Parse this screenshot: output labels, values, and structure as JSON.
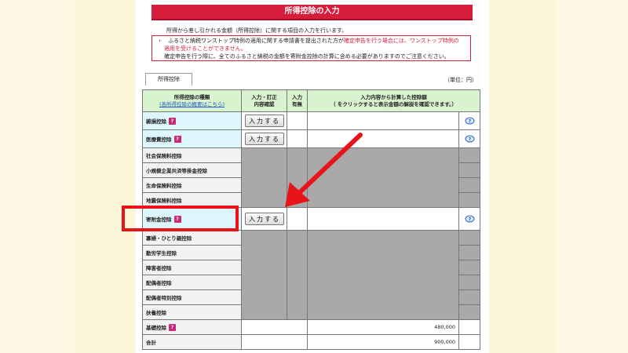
{
  "page": {
    "title": "所得控除の入力",
    "intro": "所得から差し引かれる金額（所得控除）に関する項目の入力を行います。",
    "notice_line1_black": "・　ふるさと納税ワンストップ特例の適用に関する申請書を提出された方が",
    "notice_line1_red": "確定申告を行う場合には、ワンストップ特例の",
    "notice_line2_red": "適用を受けることができません。",
    "notice_line3": "確定申告を行う際に、全てのふるさと納税の金額を寄附金控除の計算に含める必要がありますのでご注意ください。",
    "tab_label": "所得控除",
    "unit": "（単位：円）"
  },
  "table": {
    "headers": {
      "type_line1": "所得控除の種類",
      "type_link": "(各所得控除の概要はこちら)",
      "input_line1": "入力・訂正",
      "input_line2": "内容確認",
      "status_line1": "入力",
      "status_line2": "有無",
      "amount_line1": "入力内容から計算した控除額",
      "amount_line2": "（ をクリックすると表示金額の解説を確認できます。）"
    },
    "button_label": "入力する",
    "help_mark": "?",
    "rows": [
      {
        "label": "雑損控除"
      },
      {
        "label": "医療費控除"
      },
      {
        "label": "社会保険料控除"
      },
      {
        "label": "小規模企業共済等掛金控除"
      },
      {
        "label": "生命保険料控除"
      },
      {
        "label": "地震保険料控除"
      },
      {
        "label": "寄附金控除"
      },
      {
        "label": "寡婦・ひとり親控除"
      },
      {
        "label": "勤労学生控除"
      },
      {
        "label": "障害者控除"
      },
      {
        "label": "配偶者控除"
      },
      {
        "label": "配偶者特別控除"
      },
      {
        "label": "扶養控除"
      },
      {
        "label": "基礎控除",
        "amount": "480,000"
      },
      {
        "label": "合計",
        "amount": "900,000"
      }
    ]
  },
  "colors": {
    "title_bar": "#d61d3b",
    "header_bg": "#d9f3cf",
    "highlight": "#e8141a",
    "help_icon": "#c92a7a"
  }
}
